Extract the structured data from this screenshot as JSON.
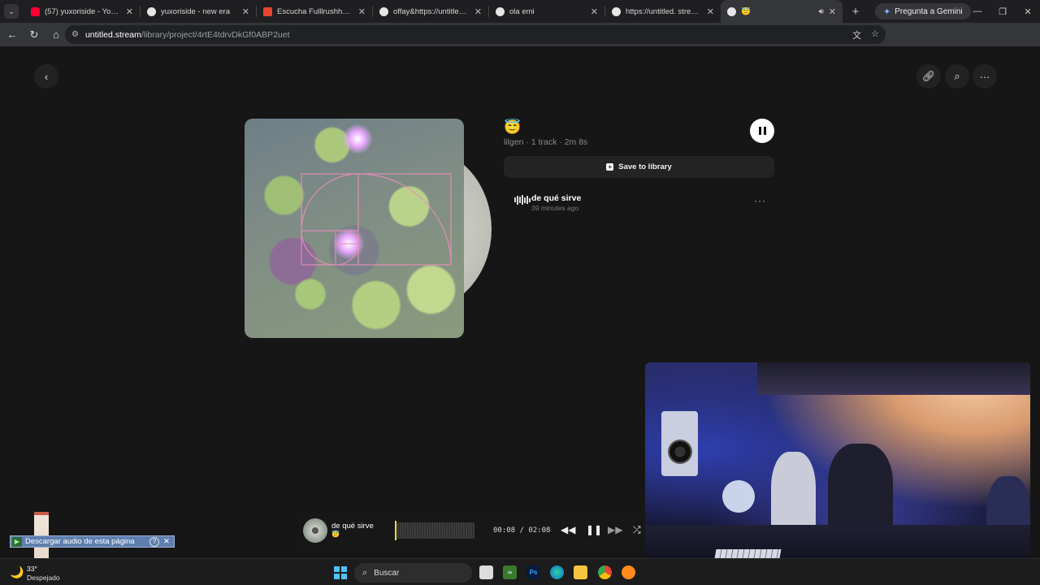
{
  "browser": {
    "tabs": [
      {
        "title": "(57) yuxoriside - YouTube",
        "favicon_color": "#ff0033"
      },
      {
        "title": "yuxoriside - new era",
        "favicon_color": "#e6e6e6"
      },
      {
        "title": "Escucha Fulllrushhhwav de",
        "favicon_color": "#e8452c"
      },
      {
        "title": "offay&https://untitled.stre",
        "favicon_color": "#e6e6e6"
      },
      {
        "title": "ola emi",
        "favicon_color": "#e6e6e6"
      },
      {
        "title": "https://untitled. stream/lib",
        "favicon_color": "#e6e6e6"
      },
      {
        "title": "😇",
        "favicon_color": "#e6e6e6",
        "active": true
      }
    ],
    "gemini_label": "Pregunta a Gemini",
    "url_host": "untitled.stream",
    "url_path": "/library/project/4rtE4tdrvDkGf0ABP2uet"
  },
  "project": {
    "emoji": "😇",
    "meta": "lilgen · 1 track · 2m 8s",
    "save_label": "Save to library",
    "accent": "#ffffff"
  },
  "tracks": [
    {
      "title": "de qué sirve",
      "time": "39 minutes ago"
    }
  ],
  "player": {
    "title": "de qué sirve",
    "emoji": "😇",
    "time": "00:08 / 02:08"
  },
  "download_bar": {
    "label": "Descargar audio de esta página",
    "help": "?",
    "close": "✕"
  },
  "taskbar": {
    "weather_temp": "33°",
    "weather_desc": "Despejado",
    "search_placeholder": "Buscar"
  }
}
